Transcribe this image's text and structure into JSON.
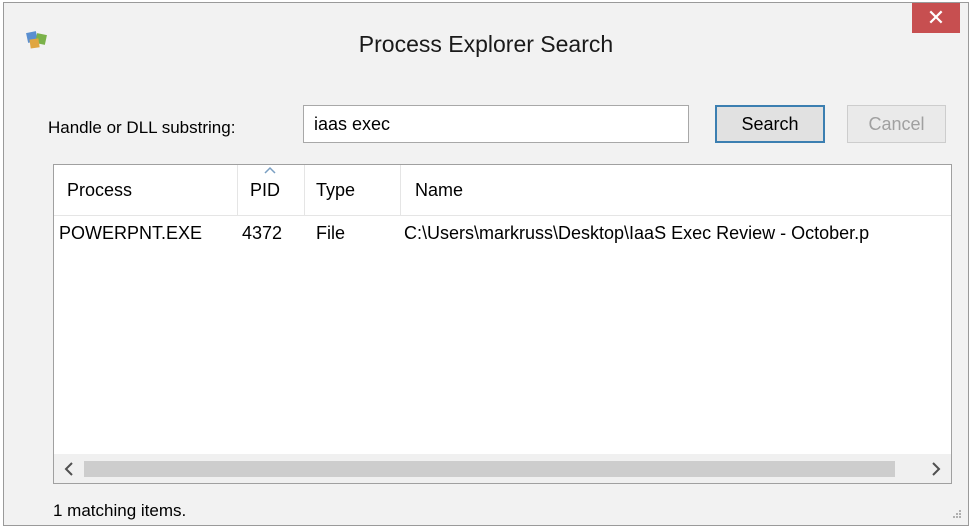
{
  "window": {
    "title": "Process Explorer Search",
    "close_glyph": "✕"
  },
  "search": {
    "label": "Handle or DLL substring:",
    "value": "iaas exec",
    "search_button": "Search",
    "cancel_button": "Cancel"
  },
  "results": {
    "columns": [
      "Process",
      "PID",
      "Type",
      "Name"
    ],
    "sorted_column": "PID",
    "rows": [
      {
        "process": "POWERPNT.EXE",
        "pid": "4372",
        "type": "File",
        "name": "C:\\Users\\markruss\\Desktop\\IaaS Exec Review - October.p"
      }
    ]
  },
  "status": {
    "text": "1 matching items."
  },
  "icons": {
    "app": "process-explorer-icon",
    "close": "close-icon",
    "scroll_left": "scroll-left-arrow-icon",
    "scroll_right": "scroll-right-arrow-icon",
    "sort": "sort-ascending-icon",
    "grip": "resize-grip-icon"
  },
  "colors": {
    "close_button": "#c74f50",
    "focused_button_border": "#3c7fb1",
    "dialog_background": "#f2f2f2"
  }
}
